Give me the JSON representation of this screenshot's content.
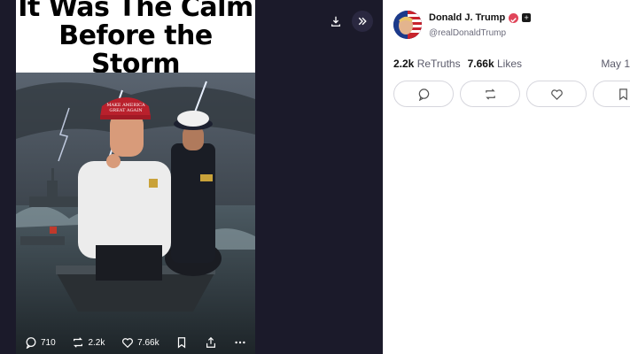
{
  "post_image": {
    "caption": "It Was The Calm Before the Storm",
    "hat_text": "MAKE AMERICA GREAT AGAIN"
  },
  "image_toolbar": {
    "replies": "710",
    "retruths": "2.2k",
    "likes": "7.66k"
  },
  "author": {
    "name": "Donald J. Trump",
    "handle": "@realDonaldTrump"
  },
  "stats": {
    "retruths_count": "2.2k",
    "retruths_label": "ReTruths",
    "likes_count": "7.66k",
    "likes_label": "Likes",
    "date": "May 1"
  },
  "icons": {
    "download": "download-icon",
    "expand": "chevrons-right-icon",
    "reply": "comment-icon",
    "retruth": "repost-icon",
    "like": "heart-icon",
    "bookmark": "bookmark-icon",
    "share": "share-icon",
    "more": "more-icon"
  },
  "colors": {
    "left_panel_bg": "#1b1a2a",
    "right_panel_bg": "#ffffff",
    "verified_badge": "#e0455a"
  }
}
